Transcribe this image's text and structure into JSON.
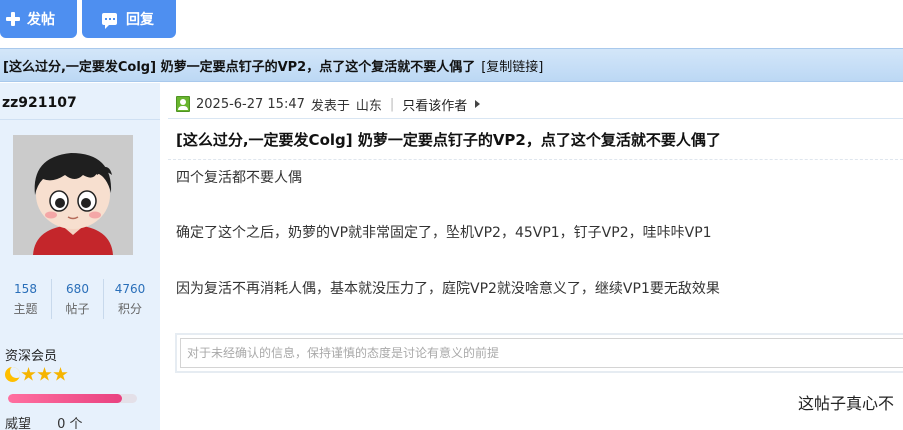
{
  "toolbar": {
    "post_label": "发帖",
    "reply_label": "回复"
  },
  "thread": {
    "title": "[这么过分,一定要发Colg] 奶萝一定要点钉子的VP2，点了这个复活就不要人偶了",
    "copy_link": "[复制链接]"
  },
  "author": {
    "username": "zz921107",
    "stats": [
      {
        "value": "158",
        "label": "主题"
      },
      {
        "value": "680",
        "label": "帖子"
      },
      {
        "value": "4760",
        "label": "积分"
      }
    ],
    "rank": "资深会员",
    "rank_icons": [
      "moon-icon",
      "star-icon",
      "star-icon",
      "star-icon"
    ],
    "rank_progress": 0.88,
    "prestige_label": "威望",
    "prestige_value": "0 个"
  },
  "post": {
    "date": "2025-6-27 15:47",
    "posted_in": "发表于",
    "location": "山东",
    "author_only": "只看该作者",
    "title": "[这么过分,一定要发Colg] 奶萝一定要点钉子的VP2，点了这个复活就不要人偶了",
    "body": [
      "四个复活都不要人偶",
      "确定了这个之后，奶萝的VP就非常固定了，坠机VP2，45VP1，钉子VP2，哇咔咔VP1",
      "因为复活不再消耗人偶，基本就没压力了，庭院VP2就没啥意义了，继续VP1要无敌效果"
    ]
  },
  "comment": {
    "placeholder": "对于未经确认的信息，保持谨慎的态度是讨论有意义的前提"
  },
  "footer_text": "这帖子真心不",
  "colors": {
    "button_blue": "#4e8ff0",
    "sidebar_bg": "#e7f1fc",
    "title_bar": "#c8e0f6",
    "progress_pink": "#e94280"
  }
}
